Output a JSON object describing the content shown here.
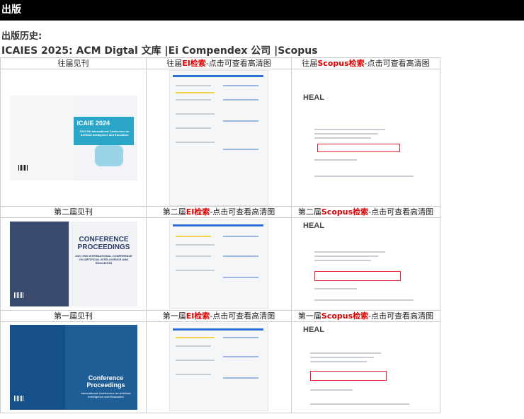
{
  "header": {
    "title": "出版"
  },
  "history_label": "出版历史:",
  "publication_line": "ICAIES 2025: ACM Digtal 文库 |Ei Compendex 公司 |Scopus",
  "rows": [
    {
      "col1": {
        "label": "往届见刊"
      },
      "col2": {
        "prefix": "往届",
        "highlight": "EI检索",
        "suffix": "-点击可查看高清图"
      },
      "col3": {
        "prefix": "往届",
        "highlight": "Scopus检索",
        "suffix": "-点击可查看高清图"
      },
      "cover_text": {
        "title": "ICAIE 2024",
        "subtitle": "2024 5th International Conference on Artificial Intelligence and Education"
      }
    },
    {
      "col1": {
        "label": "第二届见刊"
      },
      "col2": {
        "prefix": "第二届",
        "highlight": "EI检索",
        "suffix": "-点击可查看高清图"
      },
      "col3": {
        "prefix": "第二届",
        "highlight": "Scopus检索",
        "suffix": "-点击可查看高清图"
      },
      "cover_text": {
        "title": "CONFERENCE PROCEEDINGS",
        "subtitle": "2021 2ND INTERNATIONAL CONFERENCE ON ARTIFICIAL INTELLIGENCE AND EDUCATION"
      }
    },
    {
      "col1": {
        "label": "第一届见刊"
      },
      "col2": {
        "prefix": "第一届",
        "highlight": "EI检索",
        "suffix": "-点击可查看高清图"
      },
      "col3": {
        "prefix": "第一届",
        "highlight": "Scopus检索",
        "suffix": "-点击可查看高清图"
      },
      "cover_text": {
        "title": "Conference Proceedings",
        "subtitle": "International Conference on Artificial Intelligence and Education"
      }
    }
  ],
  "scopus_brand": "HEAL",
  "colors": {
    "bar": "#000000",
    "highlight": "#dd0000",
    "border": "#cccccc"
  }
}
